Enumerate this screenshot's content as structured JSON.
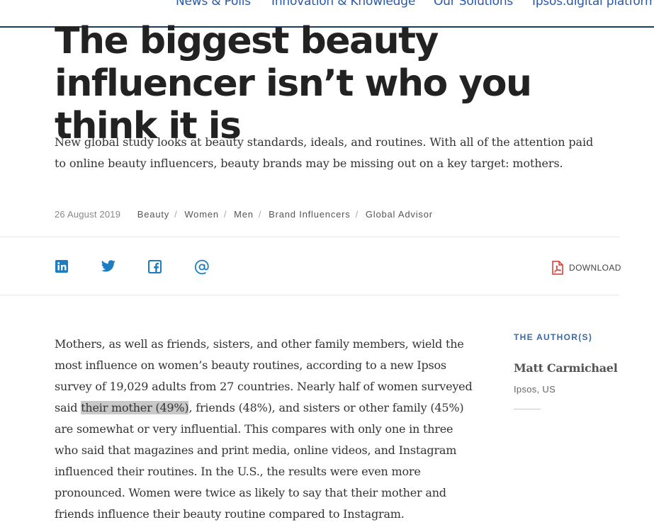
{
  "nav": {
    "items": [
      "News & Polls",
      "Innovation & Knowledge",
      "Our Solutions",
      "Ipsos.digital platform"
    ]
  },
  "article": {
    "title": "The biggest beauty influencer isn’t who you think it is",
    "summary": "New global study looks at beauty standards, ideals, and routines. With all of the attention paid to online beauty influencers, beauty brands may be missing out on a key target: mothers.",
    "date": "26 August 2019",
    "tags": [
      "Beauty",
      "Women",
      "Men",
      "Brand Influencers",
      "Global Advisor"
    ],
    "body_before": "Mothers, as well as friends, sisters, and other family members, wield the most influence on women’s beauty routines, according to a new Ipsos survey of 19,029 adults from 27 countries. Nearly half of women surveyed said ",
    "body_highlight": "their mother (49%)",
    "body_after": ", friends (48%), and sisters or other family (45%) are somewhat or very influential. This compares with only one in three who said that magazines and print media, online videos, and Instagram influenced their routines. In the U.S., the results were even more pronounced. Women were twice as likely to say that their mother and friends influence their beauty routine compared to Instagram."
  },
  "share": {
    "icons": [
      "linkedin-icon",
      "twitter-icon",
      "facebook-icon",
      "email-icon"
    ],
    "download_label": "DOWNLOAD"
  },
  "author": {
    "heading": "THE AUTHOR(S)",
    "name": "Matt Carmichael",
    "org": "Ipsos, US"
  },
  "colors": {
    "nav_link": "#2a58a8",
    "share_icons": "#1c7ec0",
    "pdf_icon": "#d9342b",
    "highlight": "#c8c8c8"
  }
}
